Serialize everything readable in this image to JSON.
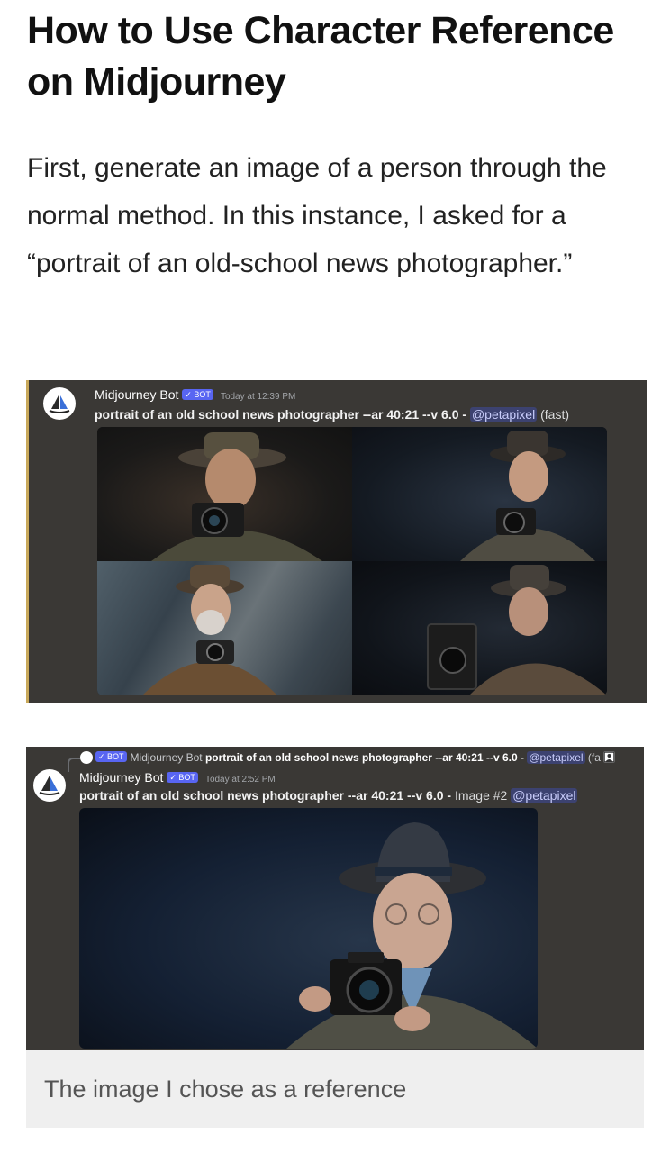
{
  "article": {
    "title": "How to Use Character Reference on Midjourney",
    "paragraph": "First, generate an image of a person through the normal method. In this instance, I asked for a “portrait of an old-school news photographer.”",
    "caption": "The image I chose as a reference"
  },
  "screenshot1": {
    "bot_name": "Midjourney Bot",
    "badge": "✓ BOT",
    "timestamp": "Today at 12:39 PM",
    "prompt": "portrait of an old school news photographer --ar 40:21 --v 6.0 - ",
    "mention": "@petapixel",
    "suffix": "(fast)"
  },
  "screenshot2": {
    "reply_badge": "✓ BOT",
    "reply_name": "Midjourney Bot",
    "reply_prompt": "portrait of an old school news photographer --ar 40:21 --v 6.0 - ",
    "reply_mention": "@petapixel",
    "reply_suffix": "(fa",
    "bot_name": "Midjourney Bot",
    "badge": "✓ BOT",
    "timestamp": "Today at 2:52 PM",
    "prompt": "portrait of an old school news photographer --ar 40:21 --v 6.0 - ",
    "image_label": "Image #2",
    "mention": "@petapixel"
  },
  "icons": {
    "avatar": "midjourney-sailboat-icon",
    "reply_image": "image-icon"
  },
  "colors": {
    "discord_bg": "#3a3835",
    "bot_badge": "#5865f2",
    "mention_bg": "#3c4270",
    "accent_border": "#c8a85a"
  }
}
